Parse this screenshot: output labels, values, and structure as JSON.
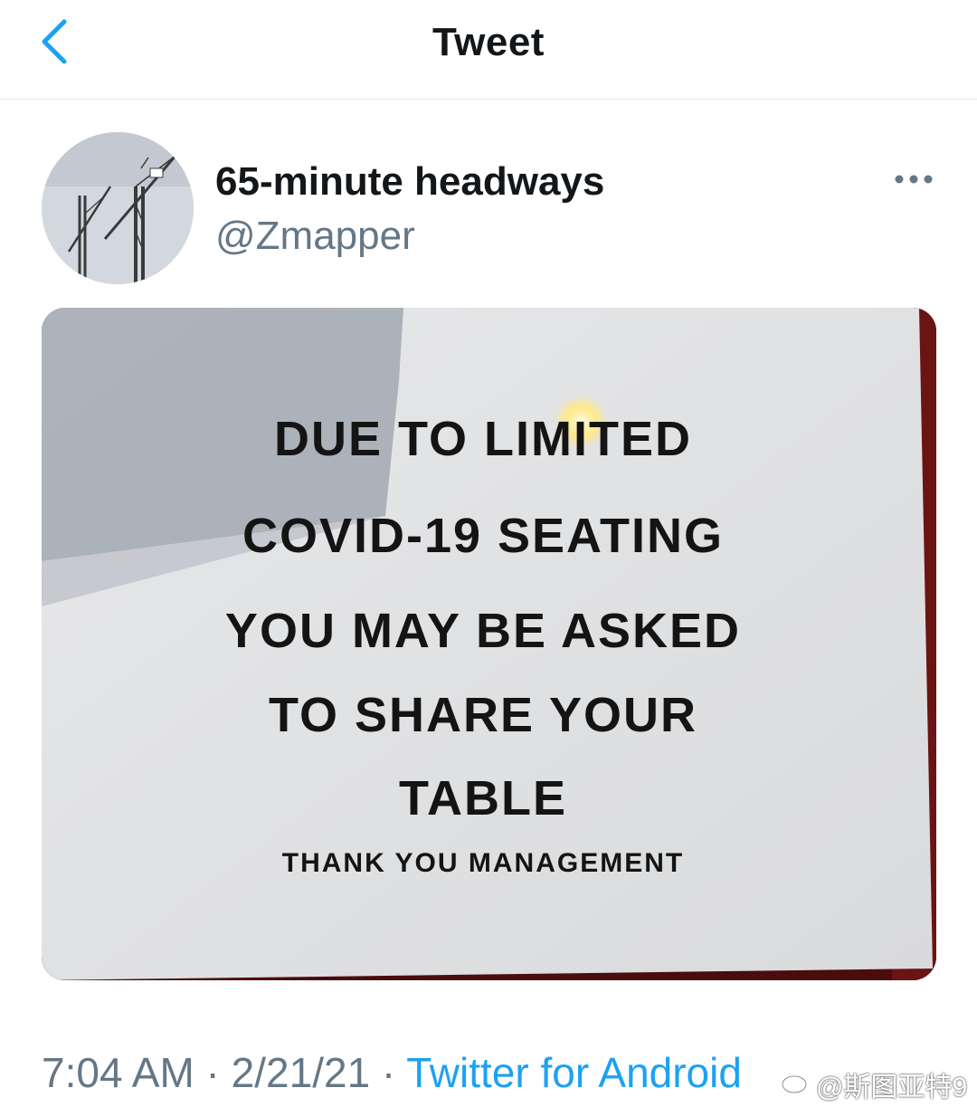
{
  "header": {
    "title": "Tweet"
  },
  "author": {
    "display_name": "65-minute headways",
    "handle": "@Zmapper"
  },
  "media": {
    "sign_lines": [
      "DUE TO LIMITED",
      "COVID-19 SEATING",
      "YOU MAY BE ASKED",
      "TO SHARE YOUR",
      "TABLE"
    ],
    "sign_footer": "THANK YOU MANAGEMENT"
  },
  "meta": {
    "time": "7:04 AM",
    "separator": " · ",
    "date": "2/21/21",
    "source": "Twitter for Android"
  },
  "watermark": {
    "text": "@斯图亚特9"
  },
  "colors": {
    "accent": "#1da1f2",
    "secondary_text": "#657786",
    "divider": "#e1e8ed"
  }
}
